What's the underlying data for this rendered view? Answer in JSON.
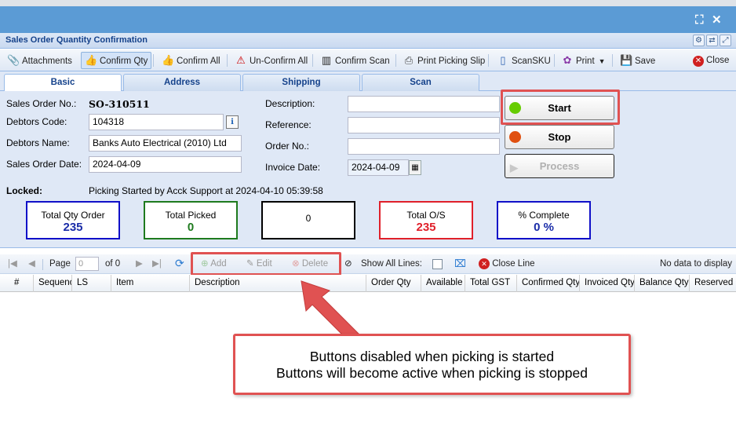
{
  "window": {
    "maximize_icon": "maximize-icon",
    "close_icon": "close-icon"
  },
  "panel": {
    "title": "Sales Order Quantity Confirmation"
  },
  "toolbar": {
    "attachments": "Attachments",
    "confirm_qty": "Confirm Qty",
    "confirm_all": "Confirm All",
    "unconfirm_all": "Un-Confirm All",
    "confirm_scan": "Confirm Scan",
    "print_picking_slip": "Print Picking Slip",
    "scan_sku": "ScanSKU",
    "print": "Print",
    "save": "Save",
    "close": "Close"
  },
  "tabs": [
    {
      "label": "Basic",
      "selected": true
    },
    {
      "label": "Address",
      "selected": false
    },
    {
      "label": "Shipping",
      "selected": false
    },
    {
      "label": "Scan",
      "selected": false
    }
  ],
  "form": {
    "sales_order_no_label": "Sales Order No.:",
    "sales_order_no": "SO-310511",
    "debtors_code_label": "Debtors Code:",
    "debtors_code": "104318",
    "debtors_name_label": "Debtors Name:",
    "debtors_name": "Banks Auto Electrical (2010) Ltd",
    "sales_order_date_label": "Sales Order Date:",
    "sales_order_date": "2024-04-09",
    "description_label": "Description:",
    "description": "",
    "reference_label": "Reference:",
    "reference": "",
    "order_no_label": "Order No.:",
    "order_no": "",
    "invoice_date_label": "Invoice Date:",
    "invoice_date": "2024-04-09",
    "locked_label": "Locked:",
    "locked_text": "Picking Started by Acck Support at 2024-04-10 05:39:58"
  },
  "actions": {
    "start": "Start",
    "stop": "Stop",
    "process": "Process",
    "start_color": "#66cc00",
    "stop_color": "#e05010"
  },
  "stats": [
    {
      "label": "Total Qty Order",
      "value": "235",
      "border": "#1010c8",
      "color": "#1a2ca8"
    },
    {
      "label": "Total Picked",
      "value": "0",
      "border": "#1e7a1e",
      "color": "#1e7a1e"
    },
    {
      "label": "",
      "value": "0",
      "border": "#000000",
      "color": "#000000"
    },
    {
      "label": "Total O/S",
      "value": "235",
      "border": "#e0202a",
      "color": "#e0202a"
    },
    {
      "label": "% Complete",
      "value": "0 %",
      "border": "#1010c8",
      "color": "#1a2ca8"
    }
  ],
  "grid_toolbar": {
    "page_label": "Page",
    "page_value": "0",
    "of_label": "of 0",
    "add": "Add",
    "edit": "Edit",
    "delete": "Delete",
    "show_all_lines": "Show All Lines:",
    "close_line": "Close Line",
    "no_data": "No data to display"
  },
  "grid_columns": [
    "#",
    "Sequenc",
    "LS",
    "Item",
    "Description",
    "Order Qty",
    "Available (",
    "Total GST",
    "Confirmed Qty",
    "Invoiced Qty",
    "Balance Qty",
    "Reserved C"
  ],
  "callout": {
    "line1": "Buttons disabled when picking is started",
    "line2": "Buttons will become active when picking is stopped"
  }
}
